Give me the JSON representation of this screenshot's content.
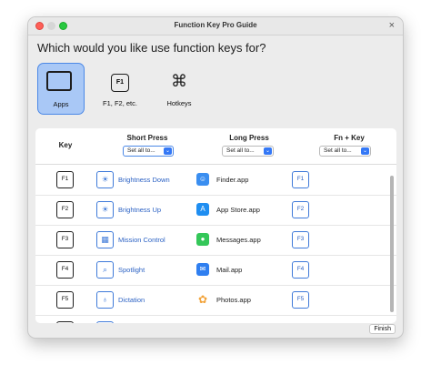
{
  "window": {
    "title": "Function Key Pro Guide",
    "close_glyph": "×"
  },
  "question": "Which would you like use function keys for?",
  "modes": [
    {
      "label": "Apps",
      "icon": "apps-windows-icon"
    },
    {
      "label": "F1, F2, etc.",
      "key_label": "F1",
      "icon": "function-key-icon"
    },
    {
      "label": "Hotkeys",
      "glyph": "⌘",
      "icon": "command-icon"
    }
  ],
  "selected_mode": "Apps",
  "table": {
    "headers": {
      "key": "Key",
      "short": "Short Press",
      "long": "Long Press",
      "fn": "Fn + Key"
    },
    "set_all": {
      "short": "Set all to...",
      "long": "Set all to...",
      "fn": "Set all to..."
    },
    "rows": [
      {
        "key": "F1",
        "short_icon": "brightness-icon",
        "short_glyph": "☀",
        "short_label": "Brightness Down",
        "long_icon": "finder-icon",
        "long_label": "Finder.app",
        "long_color": "#3a8ef0",
        "fn_key": "F1"
      },
      {
        "key": "F2",
        "short_icon": "brightness-icon",
        "short_glyph": "☀",
        "short_label": "Brightness Up",
        "long_icon": "app-store-icon",
        "long_label": "App Store.app",
        "long_color": "#1f8ef1",
        "fn_key": "F2"
      },
      {
        "key": "F3",
        "short_icon": "mission-control-icon",
        "short_glyph": "▦",
        "short_label": "Mission Control",
        "long_icon": "messages-icon",
        "long_label": "Messages.app",
        "long_color": "#34c759",
        "fn_key": "F3"
      },
      {
        "key": "F4",
        "short_icon": "spotlight-icon",
        "short_glyph": "⌕",
        "short_label": "Spotlight",
        "long_icon": "mail-icon",
        "long_label": "Mail.app",
        "long_color": "#2f7ff0",
        "fn_key": "F4"
      },
      {
        "key": "F5",
        "short_icon": "microphone-icon",
        "short_glyph": "♁",
        "short_label": "Dictation",
        "long_icon": "photos-icon",
        "long_label": "Photos.app",
        "long_color": "#f2a33a",
        "fn_key": "F5"
      },
      {
        "key": "",
        "short_icon": "partial-icon",
        "short_glyph": "",
        "short_label": "",
        "long_icon": "partial-app-icon",
        "long_label": "",
        "long_color": "#e0443e",
        "fn_key": ""
      }
    ]
  },
  "footer": {
    "finish": "Finish"
  },
  "colors": {
    "accent": "#3478f6",
    "selection": "#a9c8f6"
  }
}
